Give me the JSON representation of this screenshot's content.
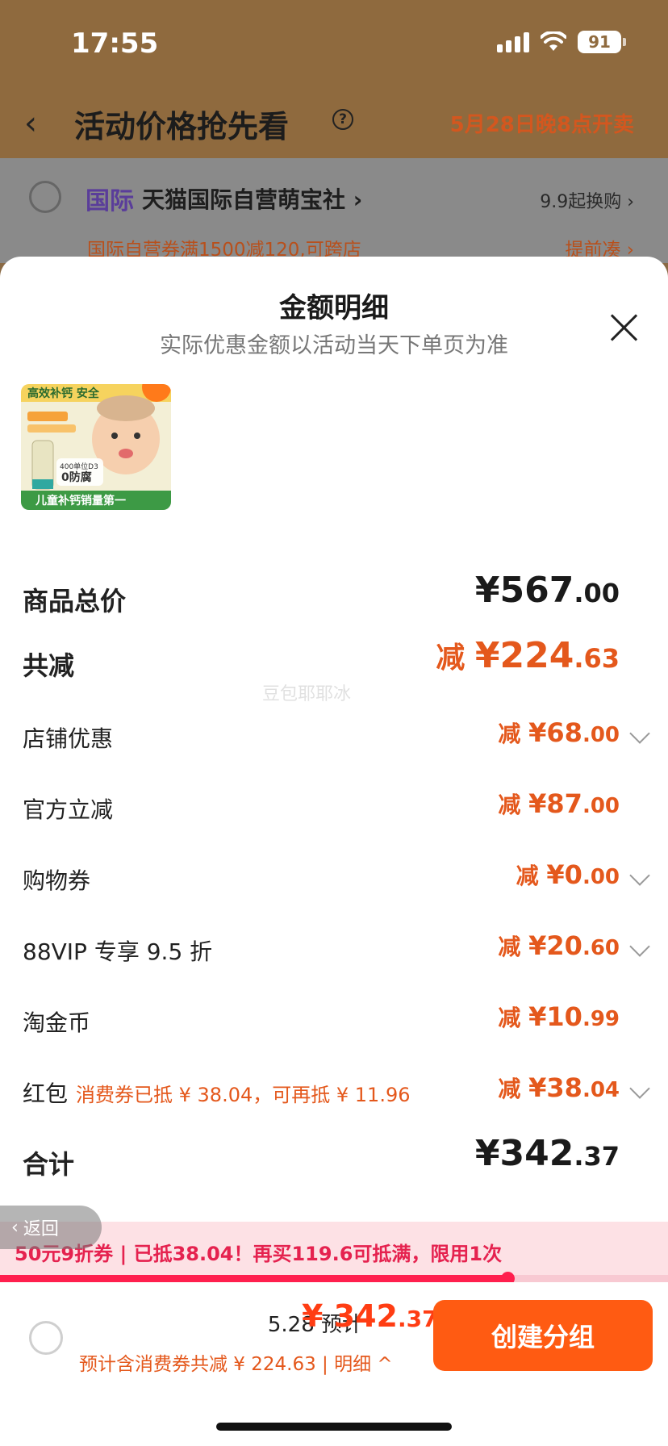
{
  "status_bar": {
    "time": "17:55",
    "battery": "91"
  },
  "nav": {
    "title": "活动价格抢先看",
    "sale_time": "5月28日晚8点开卖"
  },
  "store_card": {
    "badge": "国际",
    "store_name": "天猫国际自营萌宝社 ›",
    "swap_link": "9.9起换购 ›",
    "coupon_text": "国际自营券满1500减120,可跨店",
    "combine_link": "提前凑 ›"
  },
  "sheet": {
    "title": "金额明细",
    "subtitle": "实际优惠金额以活动当天下单页为准",
    "product_image": {
      "headline": "高效补钙 安全",
      "badge": "400单位D3\n0防腐",
      "banner": "儿童补钙销量第一"
    },
    "rows": [
      {
        "label": "商品总价",
        "prefix": "",
        "main": "¥567",
        "cents": ".00"
      },
      {
        "label": "共减",
        "prefix": "减 ",
        "main": "¥224",
        "cents": ".63"
      },
      {
        "label": "店铺优惠",
        "prefix": "减 ",
        "main": "¥68",
        "cents": ".00"
      },
      {
        "label": "官方立减",
        "prefix": "减 ",
        "main": "¥87",
        "cents": ".00"
      },
      {
        "label": "购物券",
        "prefix": "减 ",
        "main": "¥0",
        "cents": ".00"
      },
      {
        "label": "88VIP 专享 9.5 折",
        "prefix": "减 ",
        "main": "¥20",
        "cents": ".60"
      },
      {
        "label": "淘金币",
        "prefix": "减 ",
        "main": "¥10",
        "cents": ".99"
      },
      {
        "label": "红包",
        "note": "消费券已抵 ¥ 38.04，可再抵 ¥ 11.96",
        "prefix": "减 ",
        "main": "¥38",
        "cents": ".04"
      },
      {
        "label": "合计",
        "prefix": "",
        "main": "¥342",
        "cents": ".37"
      }
    ],
    "watermark": "豆包耶耶冰"
  },
  "back_pill": "返回",
  "promo": {
    "text": "50元9折券 | 已抵38.04！再买119.6可抵满，限用1次",
    "progress": 0.76
  },
  "footer": {
    "estimate_label": "5.28 预计",
    "price_main": "¥ 342",
    "price_cents": ".37",
    "note": "预计含消费券共减 ¥ 224.63 | 明细 ^",
    "button": "创建分组"
  },
  "colors": {
    "accent": "#ff5b12",
    "discount": "#e4581c",
    "promo": "#e5224f"
  }
}
